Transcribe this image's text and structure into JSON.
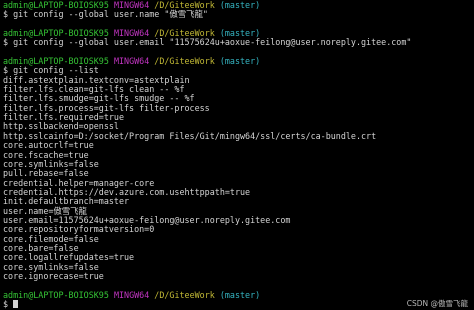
{
  "prompt": {
    "user_host": "admin@LAPTOP-BOIOSK95",
    "system": "MINGW64",
    "path": "/D/GiteeWork",
    "branch": "(master)",
    "symbol": "$"
  },
  "commands": [
    "git config --global user.name \"傲雪飞龍\"",
    "git config --global user.email \"11575624u+aoxue-feilong@user.noreply.gitee.com\"",
    "git config --list"
  ],
  "config_list": [
    "diff.astextplain.textconv=astextplain",
    "filter.lfs.clean=git-lfs clean -- %f",
    "filter.lfs.smudge=git-lfs smudge -- %f",
    "filter.lfs.process=git-lfs filter-process",
    "filter.lfs.required=true",
    "http.sslbackend=openssl",
    "http.sslcainfo=D:/socket/Program Files/Git/mingw64/ssl/certs/ca-bundle.crt",
    "core.autocrlf=true",
    "core.fscache=true",
    "core.symlinks=false",
    "pull.rebase=false",
    "credential.helper=manager-core",
    "credential.https://dev.azure.com.usehttppath=true",
    "init.defaultbranch=master",
    "user.name=傲雪飞龍",
    "user.email=11575624u+aoxue-feilong@user.noreply.gitee.com",
    "core.repositoryformatversion=0",
    "core.filemode=false",
    "core.bare=false",
    "core.logallrefupdates=true",
    "core.symlinks=false",
    "core.ignorecase=true"
  ],
  "watermark": "CSDN @傲雪飞龍",
  "colors": {
    "background": "#000000",
    "text": "#d4d4d4",
    "user_host": "#35c435",
    "system": "#c235c2",
    "path": "#c2b935",
    "branch": "#35b5c2"
  }
}
